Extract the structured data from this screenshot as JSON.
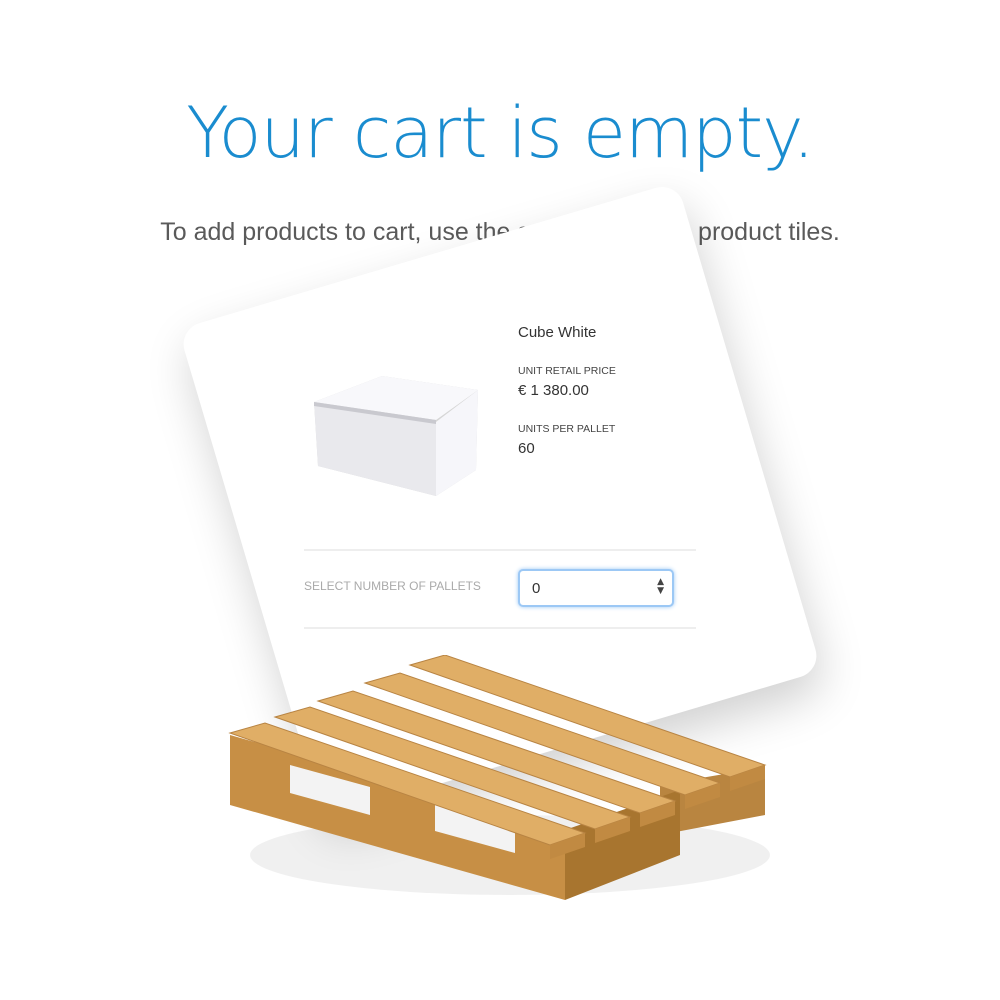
{
  "header": {
    "title": "Your cart is empty.",
    "subtitle": "To add products to cart, use the select boxes on product tiles."
  },
  "product_tile": {
    "name": "Cube White",
    "price_label": "UNIT RETAIL PRICE",
    "price": "€ 1 380.00",
    "units_label": "UNITS PER PALLET",
    "units": "60",
    "select_label": "SELECT NUMBER OF PALLETS",
    "select_value": "0"
  },
  "colors": {
    "accent": "#1a8ccf",
    "focus": "#9cc8f5",
    "wood": "#d9a55a"
  }
}
